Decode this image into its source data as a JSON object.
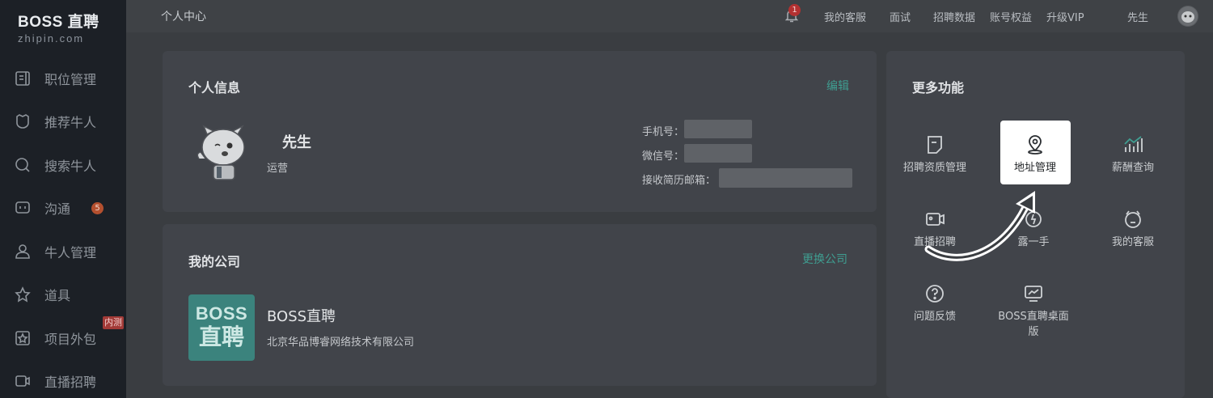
{
  "sidebar": {
    "logo_main": "BOSS 直聘",
    "logo_sub": "zhipin.com",
    "items": [
      {
        "label": "职位管理",
        "icon": "job-list-icon"
      },
      {
        "label": "推荐牛人",
        "icon": "recommend-icon"
      },
      {
        "label": "搜索牛人",
        "icon": "search-icon"
      },
      {
        "label": "沟通",
        "icon": "chat-icon",
        "badge": "5"
      },
      {
        "label": "牛人管理",
        "icon": "person-icon"
      },
      {
        "label": "道具",
        "icon": "star-badge-icon"
      },
      {
        "label": "项目外包",
        "icon": "star-box-icon",
        "tag": "内测"
      },
      {
        "label": "直播招聘",
        "icon": "video-icon"
      }
    ]
  },
  "topbar": {
    "page_title": "个人中心",
    "notification_count": "1",
    "links": [
      "我的客服",
      "面试",
      "招聘数据",
      "账号权益",
      "升级VIP"
    ],
    "user_name": "先生"
  },
  "personal_info": {
    "title": "个人信息",
    "edit_label": "编辑",
    "name": "先生",
    "role": "运营",
    "phone_label": "手机号：",
    "wechat_label": "微信号：",
    "email_label": "接收简历邮箱："
  },
  "company": {
    "title": "我的公司",
    "change_label": "更换公司",
    "logo_line1": "BOSS",
    "logo_line2": "直聘",
    "name": "BOSS直聘",
    "full_name": "北京华品博睿网络技术有限公司"
  },
  "more_features": {
    "title": "更多功能",
    "items": [
      {
        "label": "招聘资质管理",
        "icon": "document-icon"
      },
      {
        "label": "地址管理",
        "icon": "location-pin-icon",
        "highlighted": true
      },
      {
        "label": "薪酬查询",
        "icon": "bar-chart-icon"
      },
      {
        "label": "直播招聘",
        "icon": "video-icon"
      },
      {
        "label": "露一手",
        "icon": "spark-icon"
      },
      {
        "label": "我的客服",
        "icon": "service-icon"
      },
      {
        "label": "问题反馈",
        "icon": "question-icon"
      },
      {
        "label": "BOSS直聘桌面版",
        "icon": "monitor-icon"
      }
    ]
  },
  "colors": {
    "accent": "#3f9e91",
    "sidebar_bg": "#1c2026",
    "badge": "#b4502f"
  }
}
